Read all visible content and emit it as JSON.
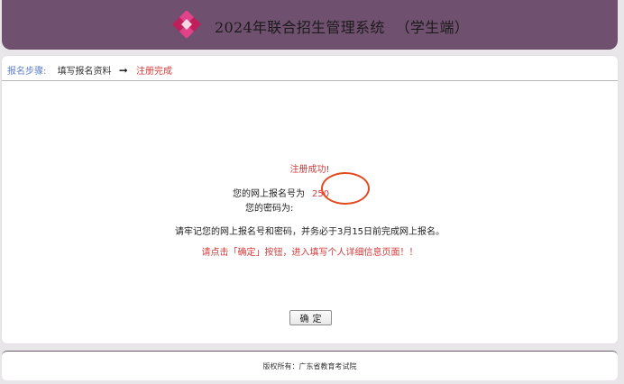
{
  "header": {
    "title": "2024年联合招生管理系统",
    "subtitle": "（学生端）",
    "logo_icon": "diamond-logo-icon",
    "background_color": "#70506f",
    "logo_colors": [
      "#c01f5b",
      "#d6367b"
    ]
  },
  "steps": {
    "label": "报名步骤:",
    "fill_form": "填写报名资料",
    "arrow": "➞",
    "complete": "注册完成"
  },
  "result": {
    "success_message": "注册成功!",
    "registration_label": "您的网上报名号为",
    "registration_number": "250",
    "password_label": "您的密码为:",
    "reminder": "请牢记您的网上报名号和密码，并务必于3月15日前完成网上报名。",
    "instruction": "请点击「确定」按钮，进入填写个人详细信息页面！！"
  },
  "confirm_button": {
    "label": "确定"
  },
  "footer": {
    "copyright": "版权所有：广东省教育考试院"
  },
  "colors": {
    "accent_red": "#d43b3b",
    "annotation_circle": "#e24a1d",
    "step_label_blue": "#5f7fc7"
  }
}
